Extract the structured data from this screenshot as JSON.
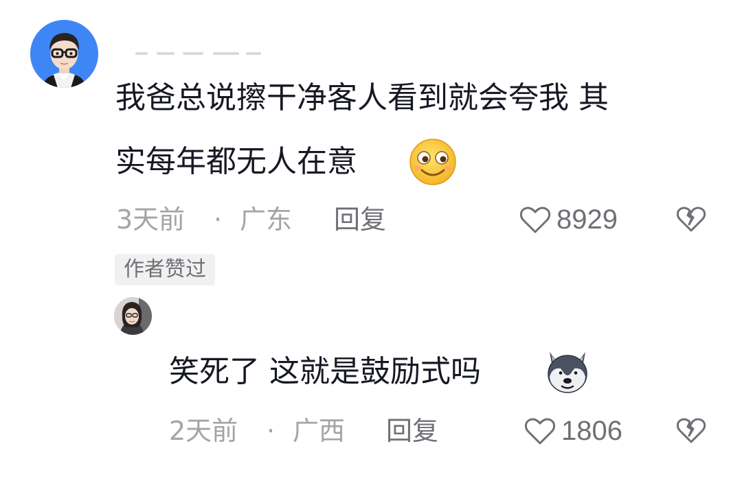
{
  "comments": [
    {
      "text_line1": "我爸总说擦干净客人看到就会夸我 其",
      "text_line2": "实每年都无人在意",
      "emoji": "smiling-face-emoji",
      "time": "3天前",
      "location": "广东",
      "separator": "·",
      "reply_label": "回复",
      "likes": "8929",
      "badge": "作者赞过"
    }
  ],
  "replies": [
    {
      "text": "笑死了 这就是鼓励式吗",
      "emoji": "husky-dog-emoji",
      "time": "2天前",
      "location": "广西",
      "separator": "·",
      "reply_label": "回复",
      "likes": "1806"
    }
  ],
  "colors": {
    "text_primary": "#161823",
    "text_meta": "#a4a4a8",
    "text_secondary": "#6f6f75",
    "badge_bg": "#f1f1f2",
    "avatar_ring": "#3b82f6"
  },
  "icons": {
    "like": "heart-outline-icon",
    "dislike": "broken-heart-icon"
  }
}
